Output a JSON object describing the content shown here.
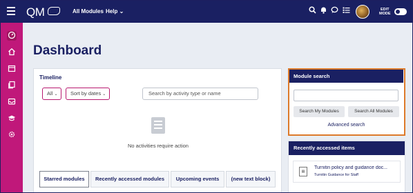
{
  "topbar": {
    "logo_text": "QM",
    "nav": [
      "All Modules",
      "Help"
    ],
    "edit_mode_label": "EDIT\nMODE"
  },
  "page": {
    "title": "Dashboard"
  },
  "timeline": {
    "heading": "Timeline",
    "filter_all": "All",
    "sort_label": "Sort by dates",
    "search_placeholder": "Search by activity type or name",
    "empty_message": "No activities require action"
  },
  "tabs": [
    {
      "label": "Starred modules",
      "active": true
    },
    {
      "label": "Recently accessed modules",
      "active": false
    },
    {
      "label": "Upcoming events",
      "active": false
    },
    {
      "label": "(new text block)",
      "active": false
    }
  ],
  "module_search": {
    "heading": "Module search",
    "input_value": "",
    "btn_my": "Search My Modules",
    "btn_all": "Search All Modules",
    "advanced": "Advanced search"
  },
  "recent_items": {
    "heading": "Recently accessed items",
    "items": [
      {
        "title": "Turnitin policy and guidance doc...",
        "subtitle": "Turnitin Guidance for Staff",
        "icon": "document-icon"
      }
    ]
  },
  "colors": {
    "brand_navy": "#1a2062",
    "sidebar_magenta": "#c0187a",
    "highlight_orange": "#dd7a2a"
  }
}
